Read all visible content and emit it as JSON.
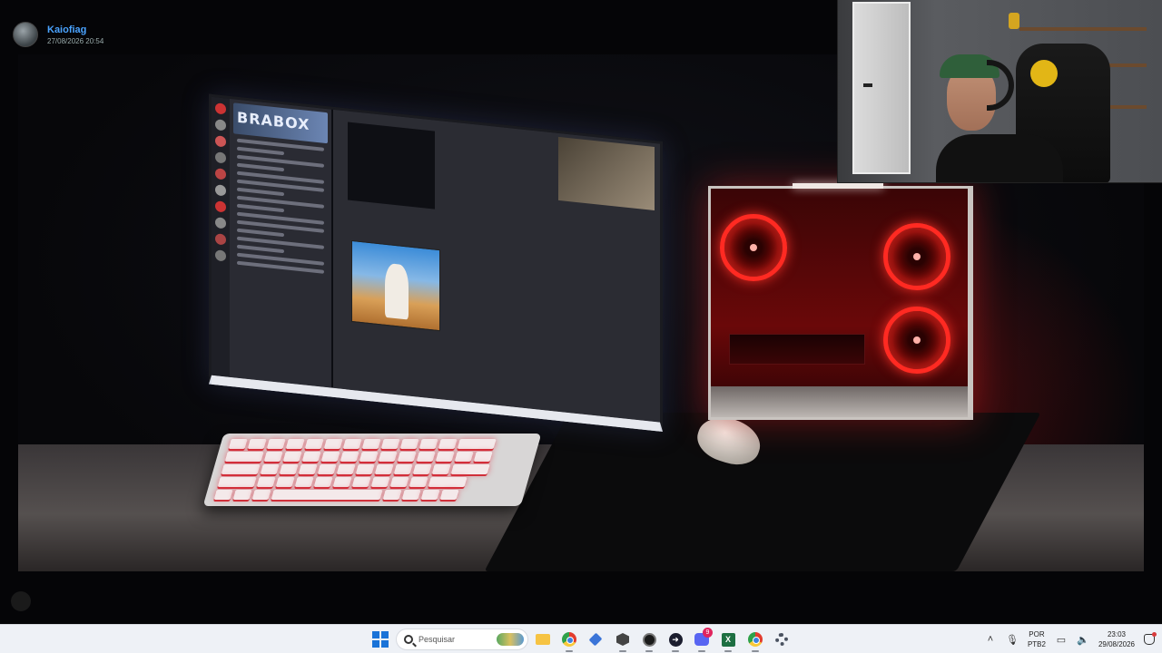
{
  "post": {
    "author": "Kaiofiag",
    "timestamp": "27/08/2026 20:54"
  },
  "monitor_screen": {
    "banner_text": "BRABOX"
  },
  "taskbar": {
    "search_placeholder": "Pesquisar",
    "discord_badge": "9",
    "lang_primary": "POR",
    "lang_secondary": "PTB2",
    "time": "23:03",
    "date": "29/08/2026"
  },
  "colors": {
    "accent_name": "#4aa3ff",
    "pc_glow": "#ff2a22",
    "keyboard_glow": "#d0303a",
    "taskbar_bg": "#eef1f6"
  },
  "icons": {
    "start": "windows-logo-icon",
    "search": "search-icon",
    "files": "folder-icon",
    "browser": "chrome-icon",
    "discord": "discord-icon",
    "excel": "excel-icon",
    "settings": "gear-icon",
    "tray": [
      "chevron-up-icon",
      "microphone-icon",
      "display-icon",
      "volume-icon",
      "notification-bell-icon"
    ]
  }
}
